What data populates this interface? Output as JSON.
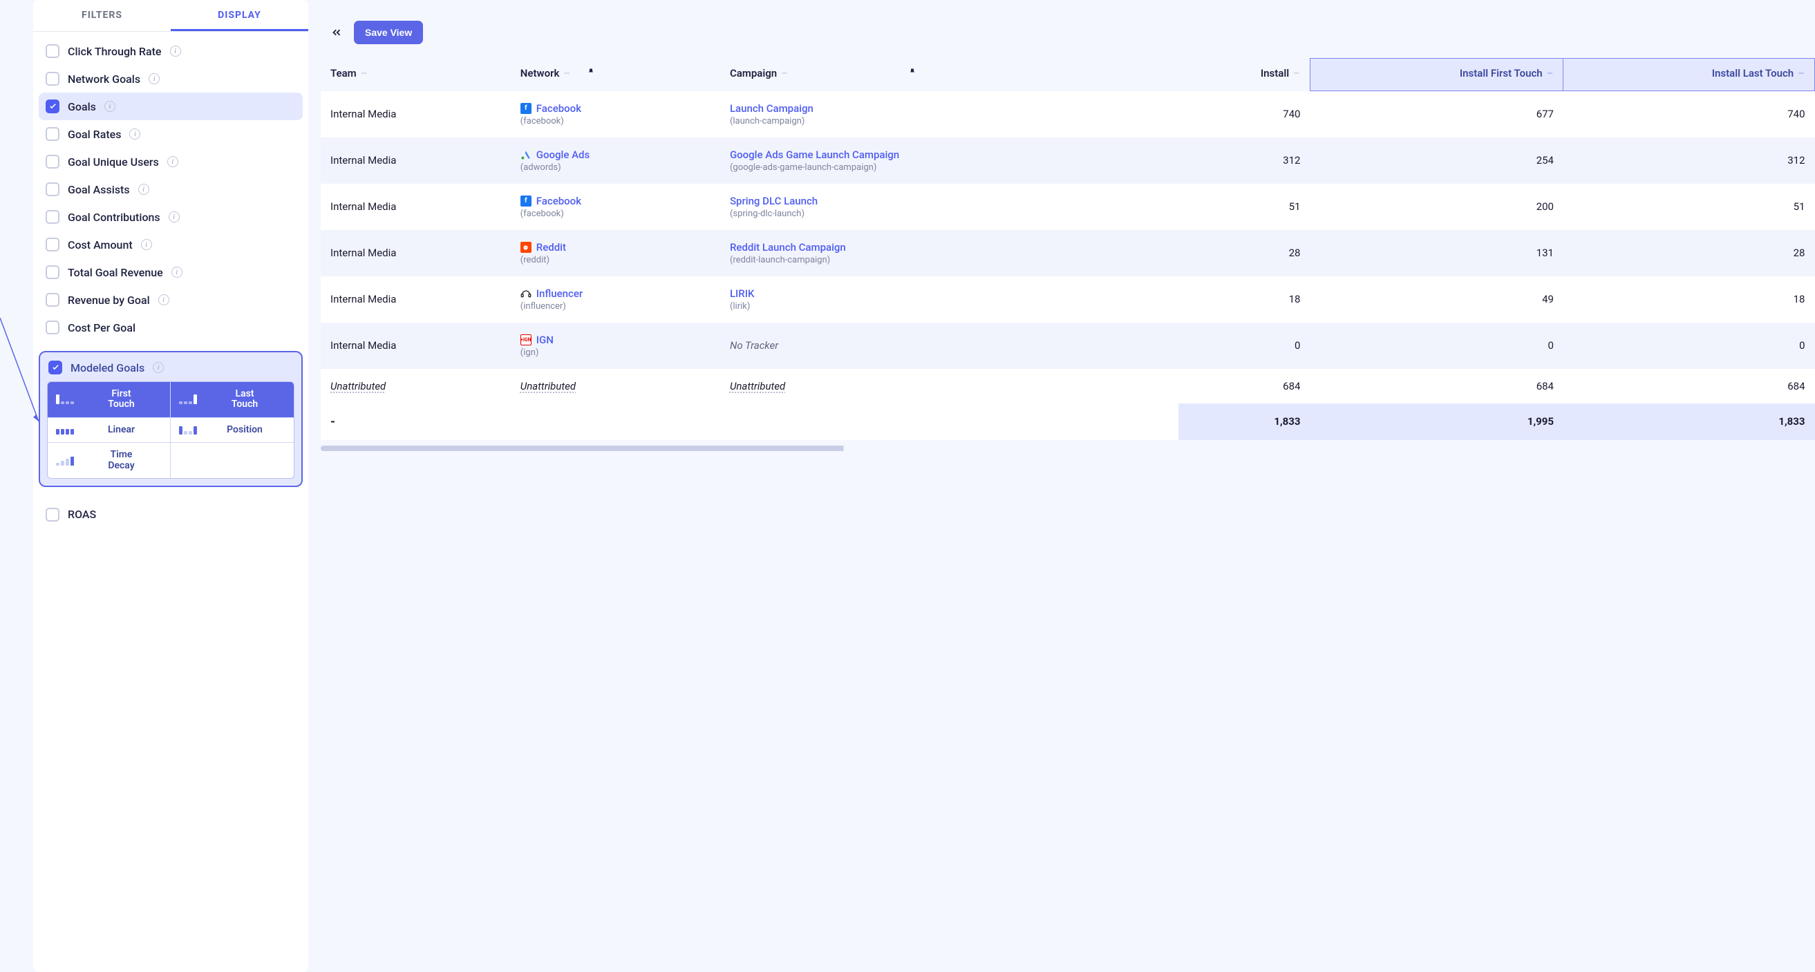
{
  "sidebar": {
    "tabs": {
      "filters": "FILTERS",
      "display": "DISPLAY"
    },
    "options": [
      {
        "label": "Click Through Rate",
        "checked": false,
        "info": true,
        "selected": false
      },
      {
        "label": "Network Goals",
        "checked": false,
        "info": true,
        "selected": false
      },
      {
        "label": "Goals",
        "checked": true,
        "info": true,
        "selected": true
      },
      {
        "label": "Goal Rates",
        "checked": false,
        "info": true,
        "selected": false
      },
      {
        "label": "Goal Unique Users",
        "checked": false,
        "info": true,
        "selected": false
      },
      {
        "label": "Goal Assists",
        "checked": false,
        "info": true,
        "selected": false
      },
      {
        "label": "Goal Contributions",
        "checked": false,
        "info": true,
        "selected": false
      },
      {
        "label": "Cost Amount",
        "checked": false,
        "info": true,
        "selected": false
      },
      {
        "label": "Total Goal Revenue",
        "checked": false,
        "info": true,
        "selected": false
      },
      {
        "label": "Revenue by Goal",
        "checked": false,
        "info": true,
        "selected": false
      },
      {
        "label": "Cost Per Goal",
        "checked": false,
        "info": false,
        "selected": false
      }
    ],
    "modeled": {
      "label": "Modeled Goals",
      "checked": true,
      "models": [
        {
          "label": "First Touch",
          "selected": true
        },
        {
          "label": "Last Touch",
          "selected": true
        },
        {
          "label": "Linear",
          "selected": false
        },
        {
          "label": "Position",
          "selected": false
        },
        {
          "label": "Time Decay",
          "selected": false
        }
      ]
    },
    "roas": {
      "label": "ROAS",
      "checked": false
    }
  },
  "toolbar": {
    "save_label": "Save View"
  },
  "table": {
    "headers": {
      "team": "Team",
      "network": "Network",
      "campaign": "Campaign",
      "install": "Install",
      "install_first": "Install First Touch",
      "install_last": "Install Last Touch"
    },
    "rows": [
      {
        "team": "Internal Media",
        "network": "Facebook",
        "network_slug": "(facebook)",
        "net_icon": "fb",
        "campaign": "Launch Campaign",
        "campaign_slug": "(launch-campaign)",
        "install": "740",
        "first": "677",
        "last": "740"
      },
      {
        "team": "Internal Media",
        "network": "Google Ads",
        "network_slug": "(adwords)",
        "net_icon": "google",
        "campaign": "Google Ads Game Launch Campaign",
        "campaign_slug": "(google-ads-game-launch-campaign)",
        "install": "312",
        "first": "254",
        "last": "312"
      },
      {
        "team": "Internal Media",
        "network": "Facebook",
        "network_slug": "(facebook)",
        "net_icon": "fb",
        "campaign": "Spring DLC Launch",
        "campaign_slug": "(spring-dlc-launch)",
        "install": "51",
        "first": "200",
        "last": "51"
      },
      {
        "team": "Internal Media",
        "network": "Reddit",
        "network_slug": "(reddit)",
        "net_icon": "reddit",
        "campaign": "Reddit Launch Campaign",
        "campaign_slug": "(reddit-launch-campaign)",
        "install": "28",
        "first": "131",
        "last": "28"
      },
      {
        "team": "Internal Media",
        "network": "Influencer",
        "network_slug": "(influencer)",
        "net_icon": "infl",
        "campaign": "LIRIK",
        "campaign_slug": "(lirik)",
        "install": "18",
        "first": "49",
        "last": "18"
      },
      {
        "team": "Internal Media",
        "network": "IGN",
        "network_slug": "(ign)",
        "net_icon": "ign",
        "campaign": "No Tracker",
        "campaign_slug": "",
        "install": "0",
        "first": "0",
        "last": "0",
        "no_tracker": true
      },
      {
        "team": "Unattributed",
        "network": "Unattributed",
        "network_slug": "",
        "campaign": "Unattributed",
        "campaign_slug": "",
        "install": "684",
        "first": "684",
        "last": "684",
        "unattributed": true
      }
    ],
    "totals": {
      "label": "-",
      "install": "1,833",
      "first": "1,995",
      "last": "1,833"
    }
  }
}
